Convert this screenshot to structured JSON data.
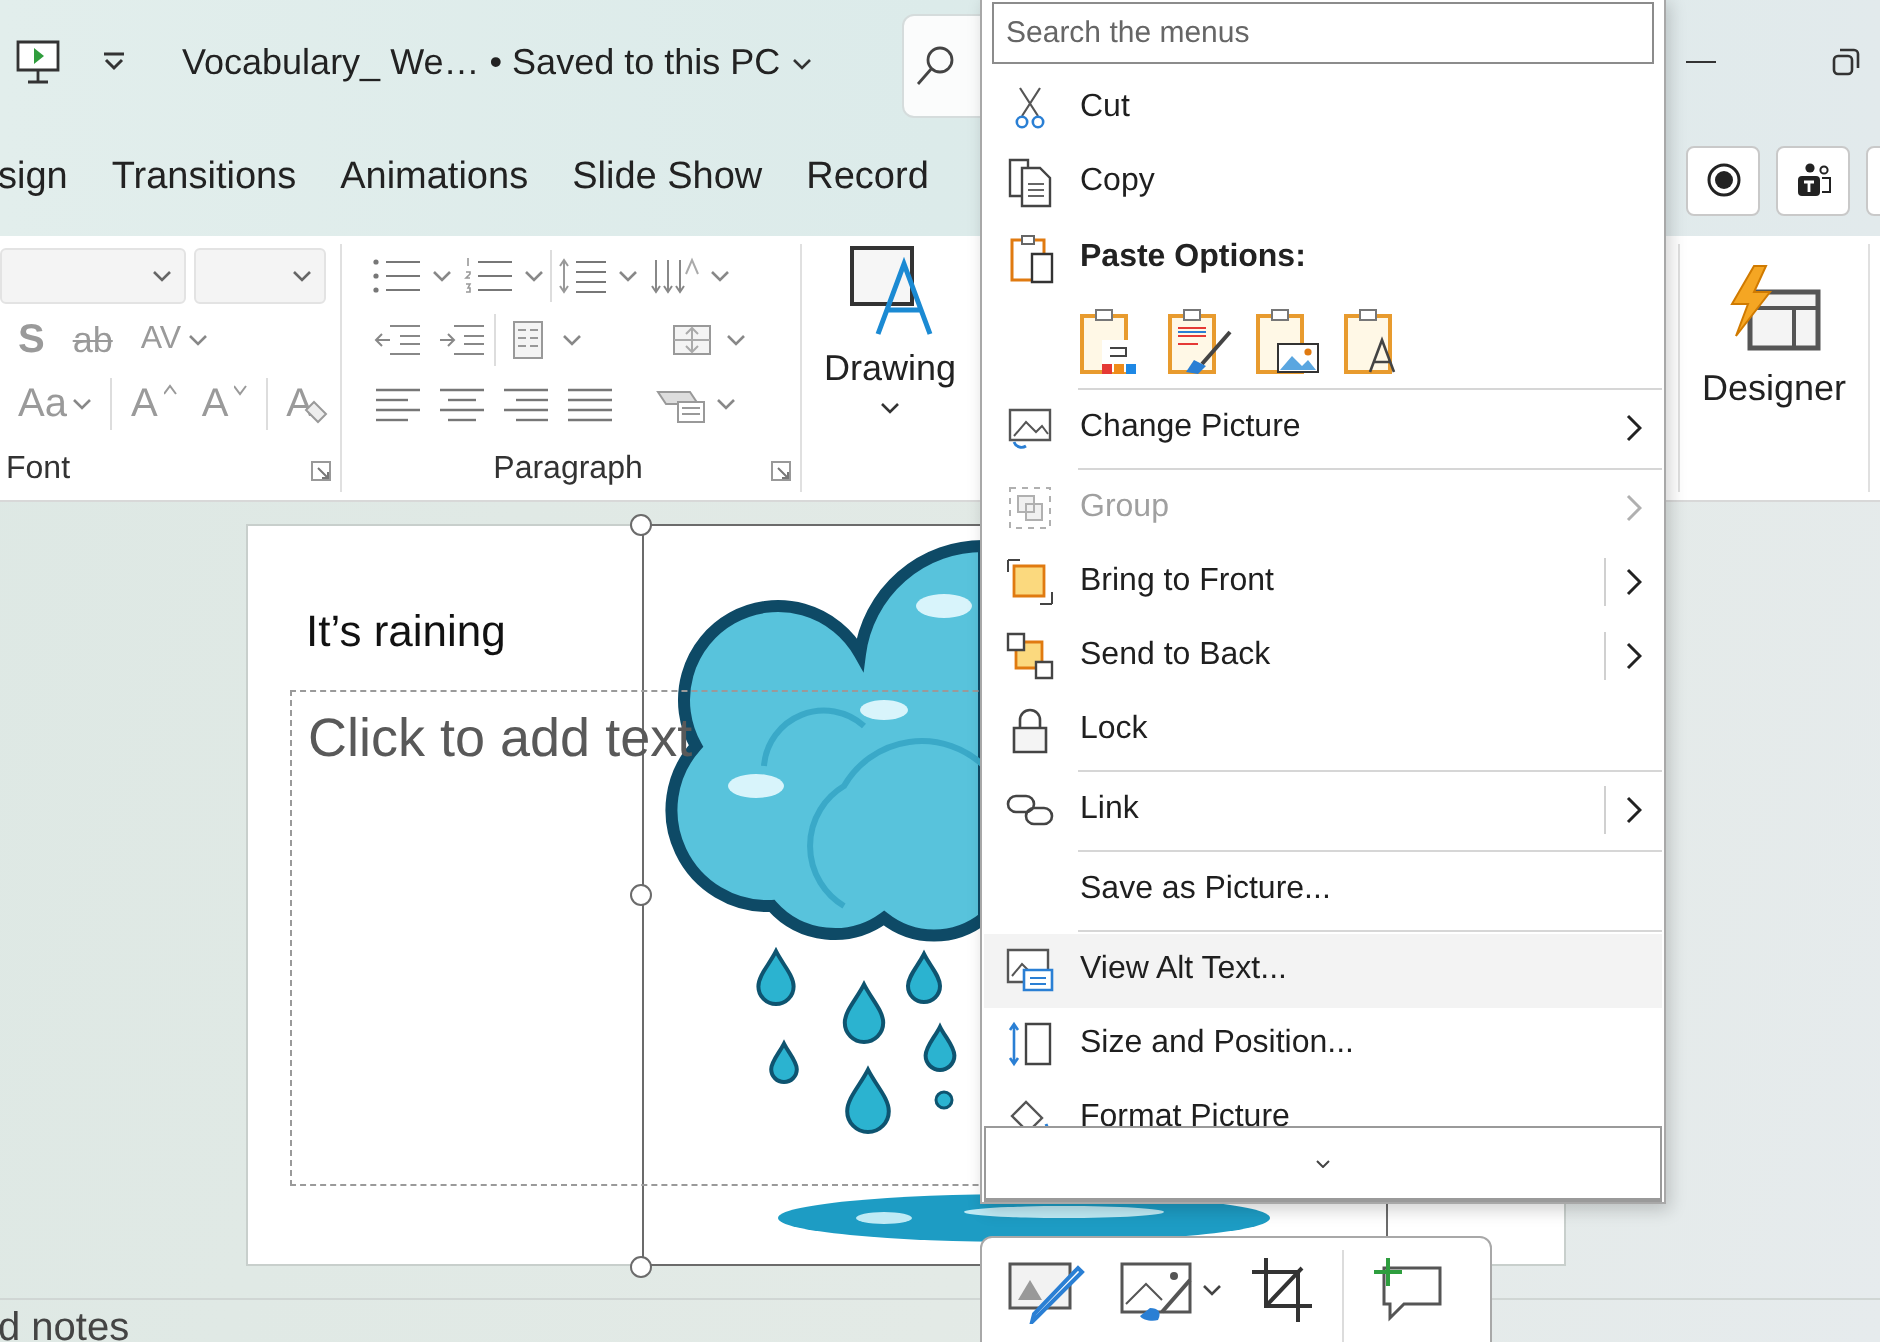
{
  "title_bar": {
    "title": "Vocabulary_ We… • Saved to this PC"
  },
  "ribbon_tabs": [
    {
      "label": "sign",
      "selected": false
    },
    {
      "label": "Transitions",
      "selected": false
    },
    {
      "label": "Animations",
      "selected": false
    },
    {
      "label": "Slide Show",
      "selected": false
    },
    {
      "label": "Record",
      "selected": false
    }
  ],
  "ribbon": {
    "font_row_1": [
      {
        "label": "S",
        "dropdown": false
      },
      {
        "label": "ab",
        "dropdown": false
      },
      {
        "label": "AV",
        "dropdown": true
      }
    ],
    "font_row_2": [
      {
        "label": "Aa",
        "dropdown": true
      },
      {
        "label": "A",
        "dropdown": false
      },
      {
        "label": "A",
        "dropdown": false
      },
      {
        "label": "A",
        "dropdown": false
      }
    ],
    "groups": [
      {
        "label": "Font"
      },
      {
        "label": "Paragraph"
      }
    ],
    "drawing": {
      "label": "Drawing"
    },
    "designer": {
      "label": "Designer"
    }
  },
  "slide": {
    "title": "It’s raining",
    "placeholder": "Click to add text"
  },
  "context_menu": {
    "search": {
      "placeholder": "Search the menus"
    },
    "items": [
      {
        "kind": "item",
        "label": "Cut",
        "submenu": false,
        "split": false,
        "disabled": false,
        "selected": false
      },
      {
        "kind": "item",
        "label": "Copy",
        "submenu": false,
        "split": false,
        "disabled": false,
        "selected": false
      },
      {
        "kind": "heading",
        "label": "Paste Options:"
      },
      {
        "kind": "paste_row"
      },
      {
        "kind": "separator"
      },
      {
        "kind": "item",
        "label": "Change Picture",
        "submenu": true,
        "split": false,
        "disabled": false,
        "selected": false
      },
      {
        "kind": "separator"
      },
      {
        "kind": "item",
        "label": "Group",
        "submenu": true,
        "split": false,
        "disabled": true,
        "selected": false
      },
      {
        "kind": "item",
        "label": "Bring to Front",
        "submenu": true,
        "split": true,
        "disabled": false,
        "selected": false
      },
      {
        "kind": "item",
        "label": "Send to Back",
        "submenu": true,
        "split": true,
        "disabled": false,
        "selected": false
      },
      {
        "kind": "item",
        "label": "Lock",
        "submenu": false,
        "split": false,
        "disabled": false,
        "selected": false
      },
      {
        "kind": "separator"
      },
      {
        "kind": "item",
        "label": "Link",
        "submenu": true,
        "split": true,
        "disabled": false,
        "selected": false
      },
      {
        "kind": "separator"
      },
      {
        "kind": "item",
        "label": "Save as Picture...",
        "submenu": false,
        "split": false,
        "disabled": false,
        "selected": false
      },
      {
        "kind": "separator"
      },
      {
        "kind": "item",
        "label": "View Alt Text...",
        "submenu": false,
        "split": false,
        "disabled": false,
        "selected": true
      },
      {
        "kind": "item",
        "label": "Size and Position...",
        "submenu": false,
        "split": false,
        "disabled": false,
        "selected": false
      },
      {
        "kind": "item",
        "label": "Format Picture",
        "submenu": false,
        "split": false,
        "disabled": false,
        "selected": false
      }
    ]
  },
  "notes": {
    "label": "d notes"
  }
}
